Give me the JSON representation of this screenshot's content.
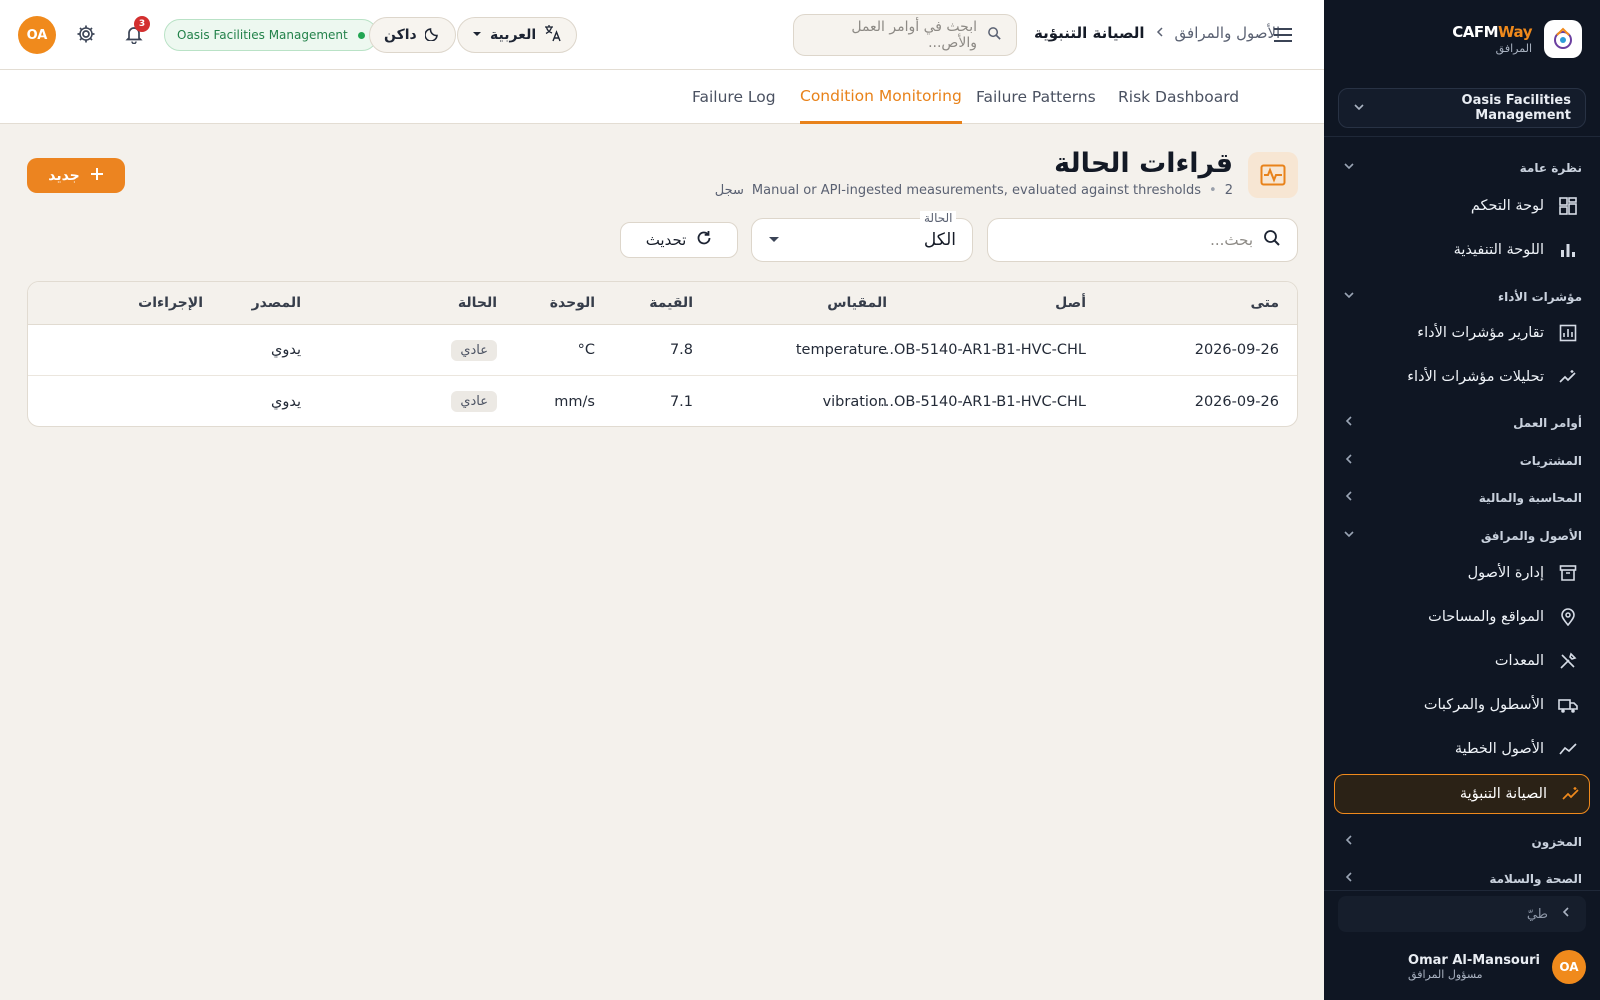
{
  "sidebar": {
    "brand_cafm": "CAFM",
    "brand_way": "Way",
    "brand_sub": "المرافق",
    "org": "Oasis Facilities Management",
    "sections": {
      "overview": "نظرة عامة",
      "kpi": "مؤشرات الأداء",
      "work_orders": "أوامر العمل",
      "procurement": "المشتريات",
      "finance": "المحاسبة والمالية",
      "assets": "الأصول والمرافق",
      "inventory": "المخزون",
      "hse": "الصحة والسلامة"
    },
    "items": {
      "dashboard": "لوحة التحكم",
      "executive": "اللوحة التنفيذية",
      "kpi_reports": "تقارير مؤشرات الأداء",
      "kpi_analytics": "تحليلات مؤشرات الأداء",
      "asset_mgmt": "إدارة الأصول",
      "locations": "المواقع والمساحات",
      "equipment": "المعدات",
      "fleet": "الأسطول والمركبات",
      "linear": "الأصول الخطية",
      "predictive": "الصيانة التنبؤية"
    },
    "collapse_label": "طيّ",
    "user": {
      "initials": "OA",
      "name": "Omar Al-Mansouri",
      "role": "مسؤول المرافق"
    }
  },
  "header": {
    "avatar": "OA",
    "notifications": "3",
    "org_pill": "Oasis Facilities Management",
    "theme": "داكن",
    "language": "العربية",
    "search_placeholder": "ابحث في أوامر العمل والأص...",
    "breadcrumb": {
      "parent": "الأصول والمرافق",
      "current": "الصيانة التنبؤية"
    }
  },
  "tabs": [
    "Risk Dashboard",
    "Failure Patterns",
    "Condition Monitoring",
    "Failure Log"
  ],
  "page": {
    "title": "قراءات الحالة",
    "count": "2",
    "subtitle": "Manual or API-ingested measurements, evaluated against thresholds",
    "records_word": "سجل",
    "new_button": "جديد",
    "search_placeholder": "بحث...",
    "status_label": "الحالة",
    "status_value": "الكل",
    "refresh_button": "تحديث"
  },
  "table": {
    "headers": {
      "when": "متى",
      "asset": "أصل",
      "metric": "المقياس",
      "value": "القيمة",
      "unit": "الوحدة",
      "status": "الحالة",
      "source": "المصدر",
      "actions": "الإجراءات"
    },
    "rows": [
      {
        "when": "2026-09-26",
        "asset": "...OB-5140-AR1-B1-HVC-CHL",
        "metric": "temperature",
        "value": "7.8",
        "unit": "°C",
        "status": "عادي",
        "source": "يدوي"
      },
      {
        "when": "2026-09-26",
        "asset": "...OB-5140-AR1-B1-HVC-CHL",
        "metric": "vibration",
        "value": "7.1",
        "unit": "mm/s",
        "status": "عادي",
        "source": "يدوي"
      }
    ]
  },
  "colors": {
    "accent": "#ec8420",
    "sidebar_bg": "#0f1623",
    "page_bg": "#f4f1ec",
    "ok_green": "#22a653"
  }
}
